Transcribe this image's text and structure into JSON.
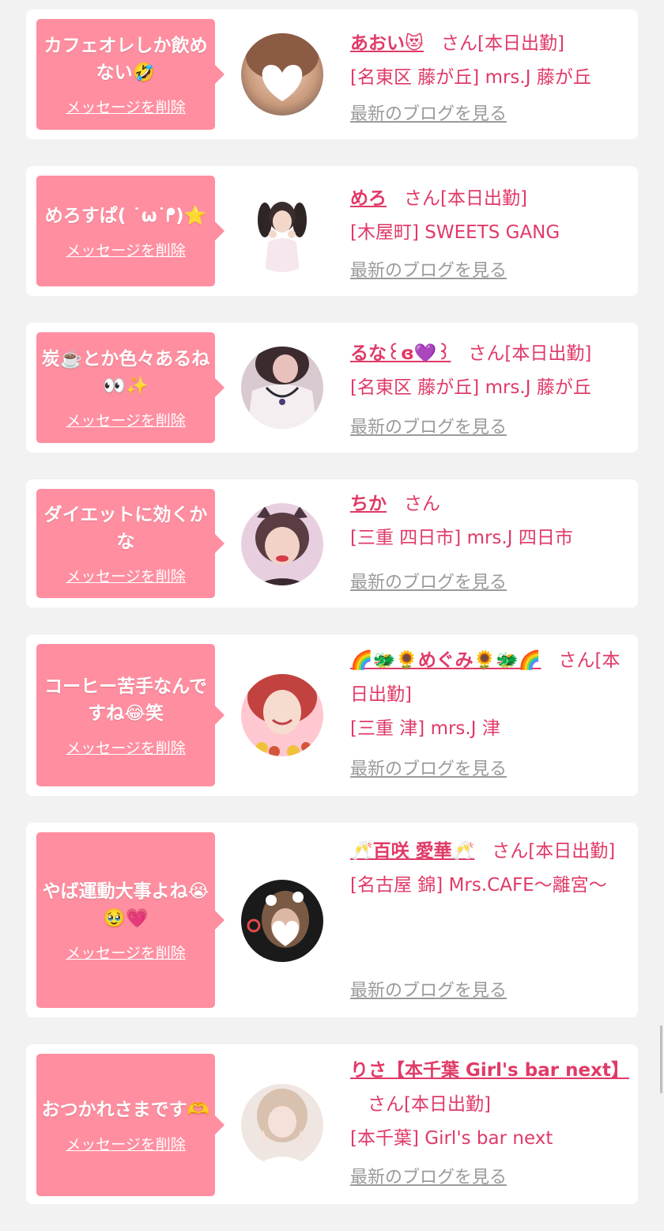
{
  "delete_label": "メッセージを削除",
  "blog_label": "最新のブログを見る",
  "san_label": "さん",
  "cards": [
    {
      "message": "カフェオレしか飲めない🤣",
      "name": "あおい😻",
      "status": "[本日出勤]",
      "shop": "[名東区 藤が丘] mrs.J 藤が丘",
      "avatar_icon": "blurred-heart-avatar"
    },
    {
      "message": "めろすぱ( ˙ω˙ᖰ)⭐️",
      "name": "めろ",
      "status": "[本日出勤]",
      "shop": "[木屋町] SWEETS GANG",
      "avatar_icon": "pigtail-girl-avatar"
    },
    {
      "message": "炭☕️とか色々あるね👀✨",
      "name": "るな꒰ɞ💜꒱",
      "status": "[本日出勤]",
      "shop": "[名東区 藤が丘] mrs.J 藤が丘",
      "avatar_icon": "lace-dress-avatar"
    },
    {
      "message": "ダイエットに効くかな",
      "name": "ちか",
      "status": "",
      "shop": "[三重 四日市] mrs.J 四日市",
      "avatar_icon": "cat-ear-avatar"
    },
    {
      "message": "コーヒー苦手なんですね😂笑",
      "name": "🌈🐲🌻めぐみ🌻🐲🌈",
      "status": "[本日出勤]",
      "shop": "[三重 津] mrs.J 津",
      "avatar_icon": "smiling-woman-avatar"
    },
    {
      "message": "やば運動大事よね😭🥹💗",
      "name": "🥂百咲 愛華🥂",
      "status": "[本日出勤]",
      "shop": "[名古屋 錦] Mrs.CAFE～離宮～",
      "avatar_icon": "bow-filter-avatar"
    },
    {
      "message": "おつかれさまです🫶",
      "name": "りさ【本千葉 Girl's bar next】",
      "status": "[本日出勤]",
      "shop": "[本千葉] Girl's bar next",
      "avatar_icon": "peace-sign-avatar"
    }
  ]
}
